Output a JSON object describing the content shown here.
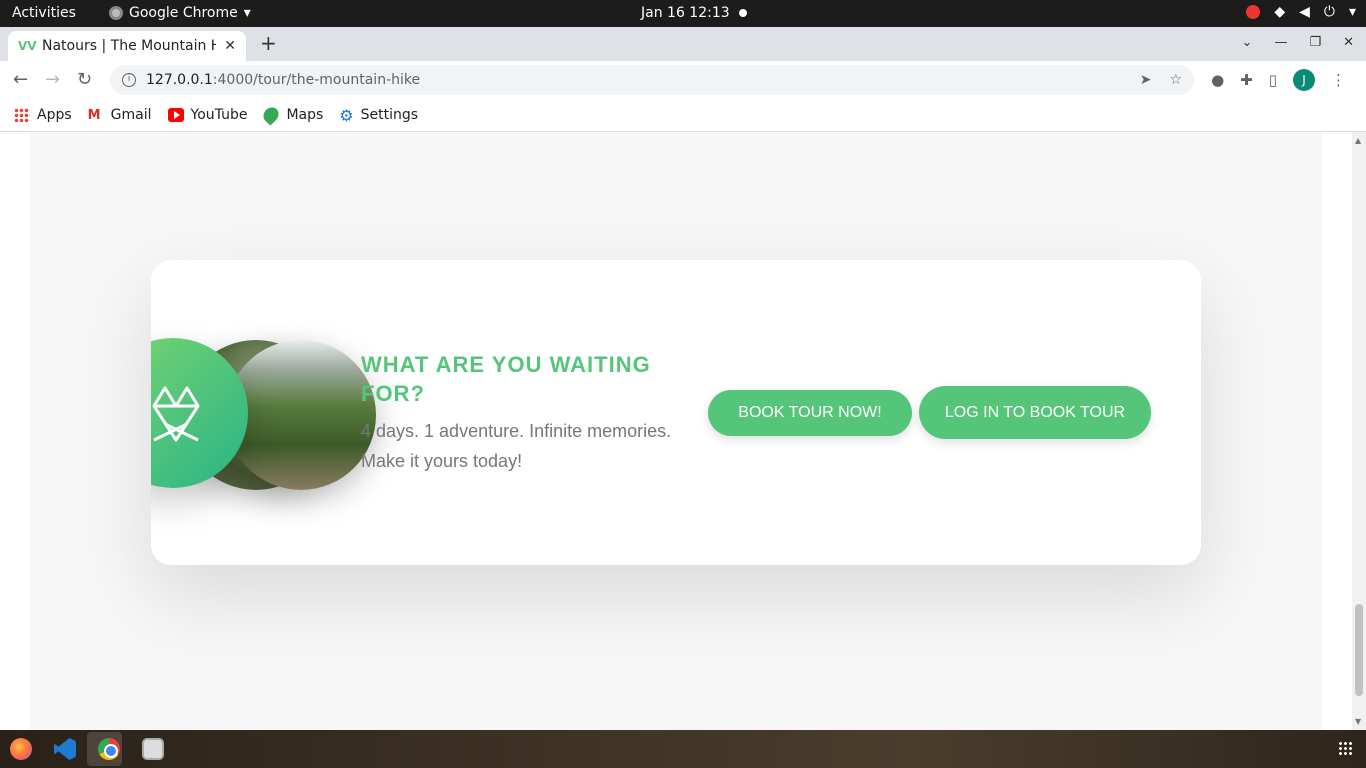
{
  "system": {
    "activities": "Activities",
    "app_name": "Google Chrome",
    "clock": "Jan 16  12:13"
  },
  "browser": {
    "tab_title": "Natours | The Mountain H",
    "url_host": "127.0.0.1",
    "url_rest": ":4000/tour/the-mountain-hike",
    "avatar_letter": "J",
    "bookmarks": [
      {
        "label": "Apps",
        "icon": "apps-grid-icon"
      },
      {
        "label": "Gmail",
        "icon": "gmail-icon"
      },
      {
        "label": "YouTube",
        "icon": "youtube-icon"
      },
      {
        "label": "Maps",
        "icon": "maps-icon"
      },
      {
        "label": "Settings",
        "icon": "settings-gear-icon"
      }
    ]
  },
  "cta": {
    "heading": "What are you waiting for?",
    "text": "4 days. 1 adventure. Infinite memories. Make it yours today!",
    "book_button": "BOOK TOUR NOW!",
    "login_button": "LOG IN TO BOOK TOUR",
    "accent_color": "#55c57a"
  },
  "dock": [
    "firefox-icon",
    "vscode-icon",
    "chrome-icon",
    "files-icon"
  ]
}
